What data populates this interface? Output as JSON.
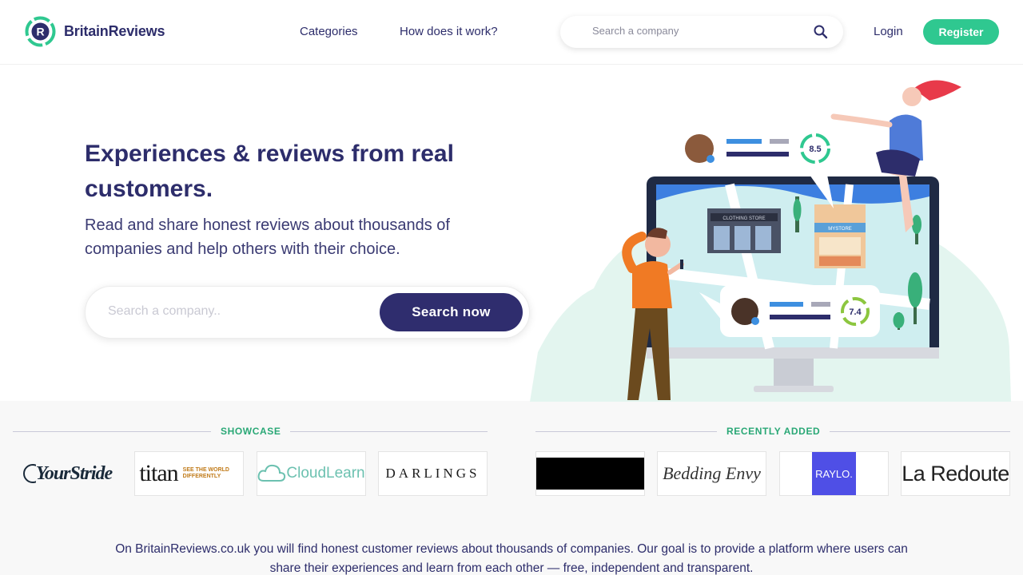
{
  "header": {
    "brand": "BritainReviews",
    "nav": {
      "categories": "Categories",
      "how": "How does it work?"
    },
    "search_placeholder": "Search a company",
    "login": "Login",
    "register": "Register"
  },
  "hero": {
    "title": "Experiences & reviews from real customers.",
    "subtitle": "Read and share honest reviews about thousands of companies and help others with their choice.",
    "search_placeholder": "Search a company..",
    "search_button": "Search now",
    "illustration": {
      "store_sign_1": "CLOTHING STORE",
      "store_sign_2": "MYSTORE",
      "score_1": "8.5",
      "score_2": "7.4"
    }
  },
  "showcase": {
    "label": "SHOWCASE",
    "logos": [
      "YourStride",
      "titan",
      "CloudLearn",
      "DARLINGS"
    ],
    "titan_tagline": "SEE THE WORLD DIFFERENTLY"
  },
  "recently_added": {
    "label": "RECENTLY ADDED",
    "logos": [
      "Bedding Envy",
      "RAYLO.",
      "La Redoute"
    ]
  },
  "footer": {
    "text": "On BritainReviews.co.uk you will find honest customer reviews about thousands of companies. Our goal is to provide a platform where users can share their experiences and learn from each other — free, independent and transparent."
  },
  "colors": {
    "brand_navy": "#2d2d6b",
    "accent_green": "#2fc890",
    "button_navy": "#2f2d6e"
  }
}
